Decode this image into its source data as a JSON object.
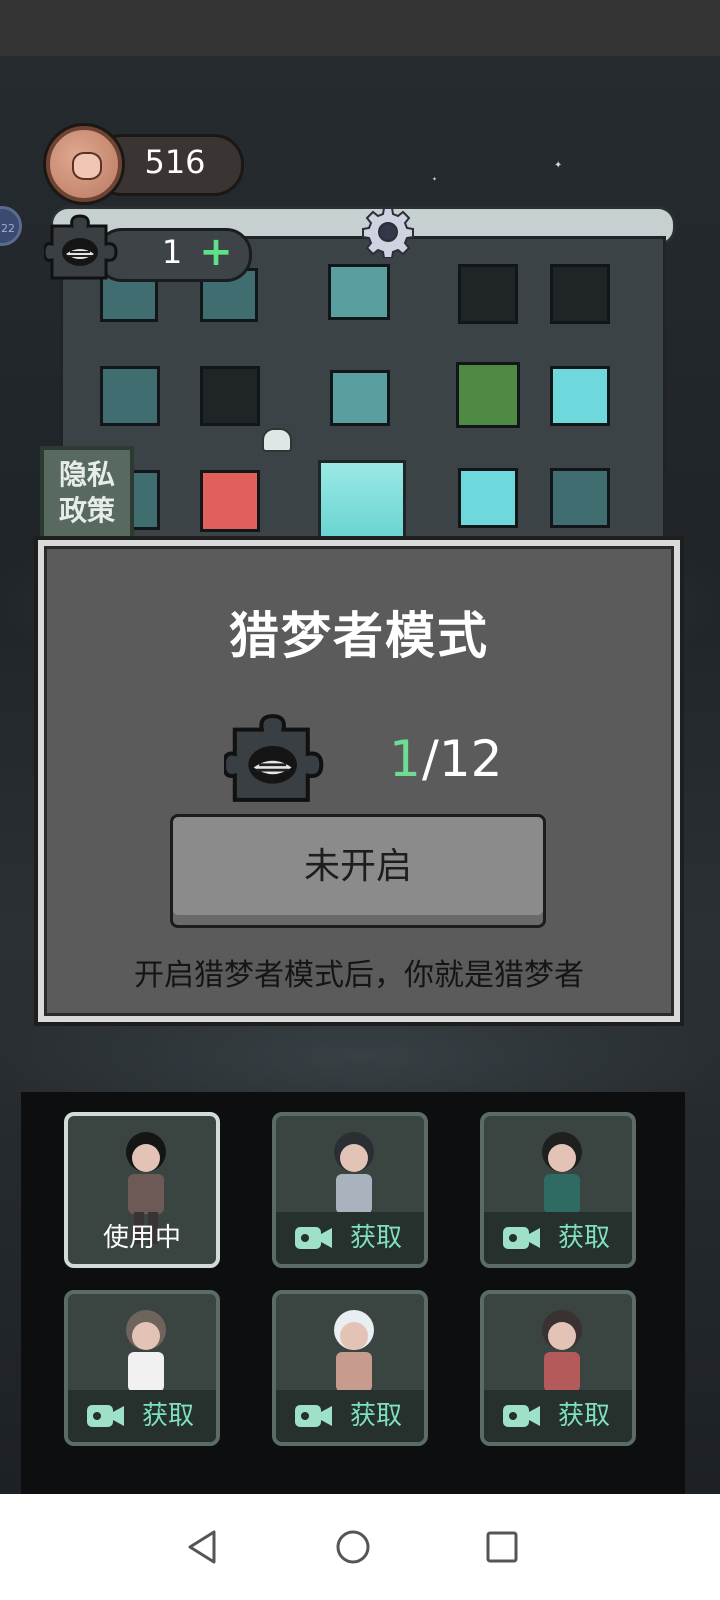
{
  "hud": {
    "coins": "516",
    "dream_pieces": "1",
    "side_badge": "22"
  },
  "privacy": {
    "label": "隐私\n政策"
  },
  "panel": {
    "title": "猎梦者模式",
    "progress_current": "1",
    "progress_rest": "/12",
    "button_label": "未开启",
    "description": "开启猎梦者模式后，你就是猎梦者"
  },
  "characters": [
    {
      "status": "使用中",
      "selected": true,
      "hair": "#151515",
      "top": "#6d5a57",
      "bottom": "#3a3333"
    },
    {
      "status": "获取",
      "selected": false,
      "hair": "#2b2e33",
      "top": "#a9b3bd",
      "bottom": "#2a2a2a"
    },
    {
      "status": "获取",
      "selected": false,
      "hair": "#1f1f1f",
      "top": "#2f6b63",
      "bottom": "#1a1a1a"
    },
    {
      "status": "获取",
      "selected": false,
      "hair": "#6e645c",
      "top": "#f1f1f1",
      "bottom": "#3d3a36"
    },
    {
      "status": "获取",
      "selected": false,
      "hair": "#e9eef2",
      "top": "#c79c8f",
      "bottom": "#4a3d37"
    },
    {
      "status": "获取",
      "selected": false,
      "hair": "#3a3232",
      "top": "#b55a5a",
      "bottom": "#2f3a52"
    }
  ],
  "colors": {
    "accent_green": "#6fdc94",
    "get_text": "#7fe0bf"
  }
}
